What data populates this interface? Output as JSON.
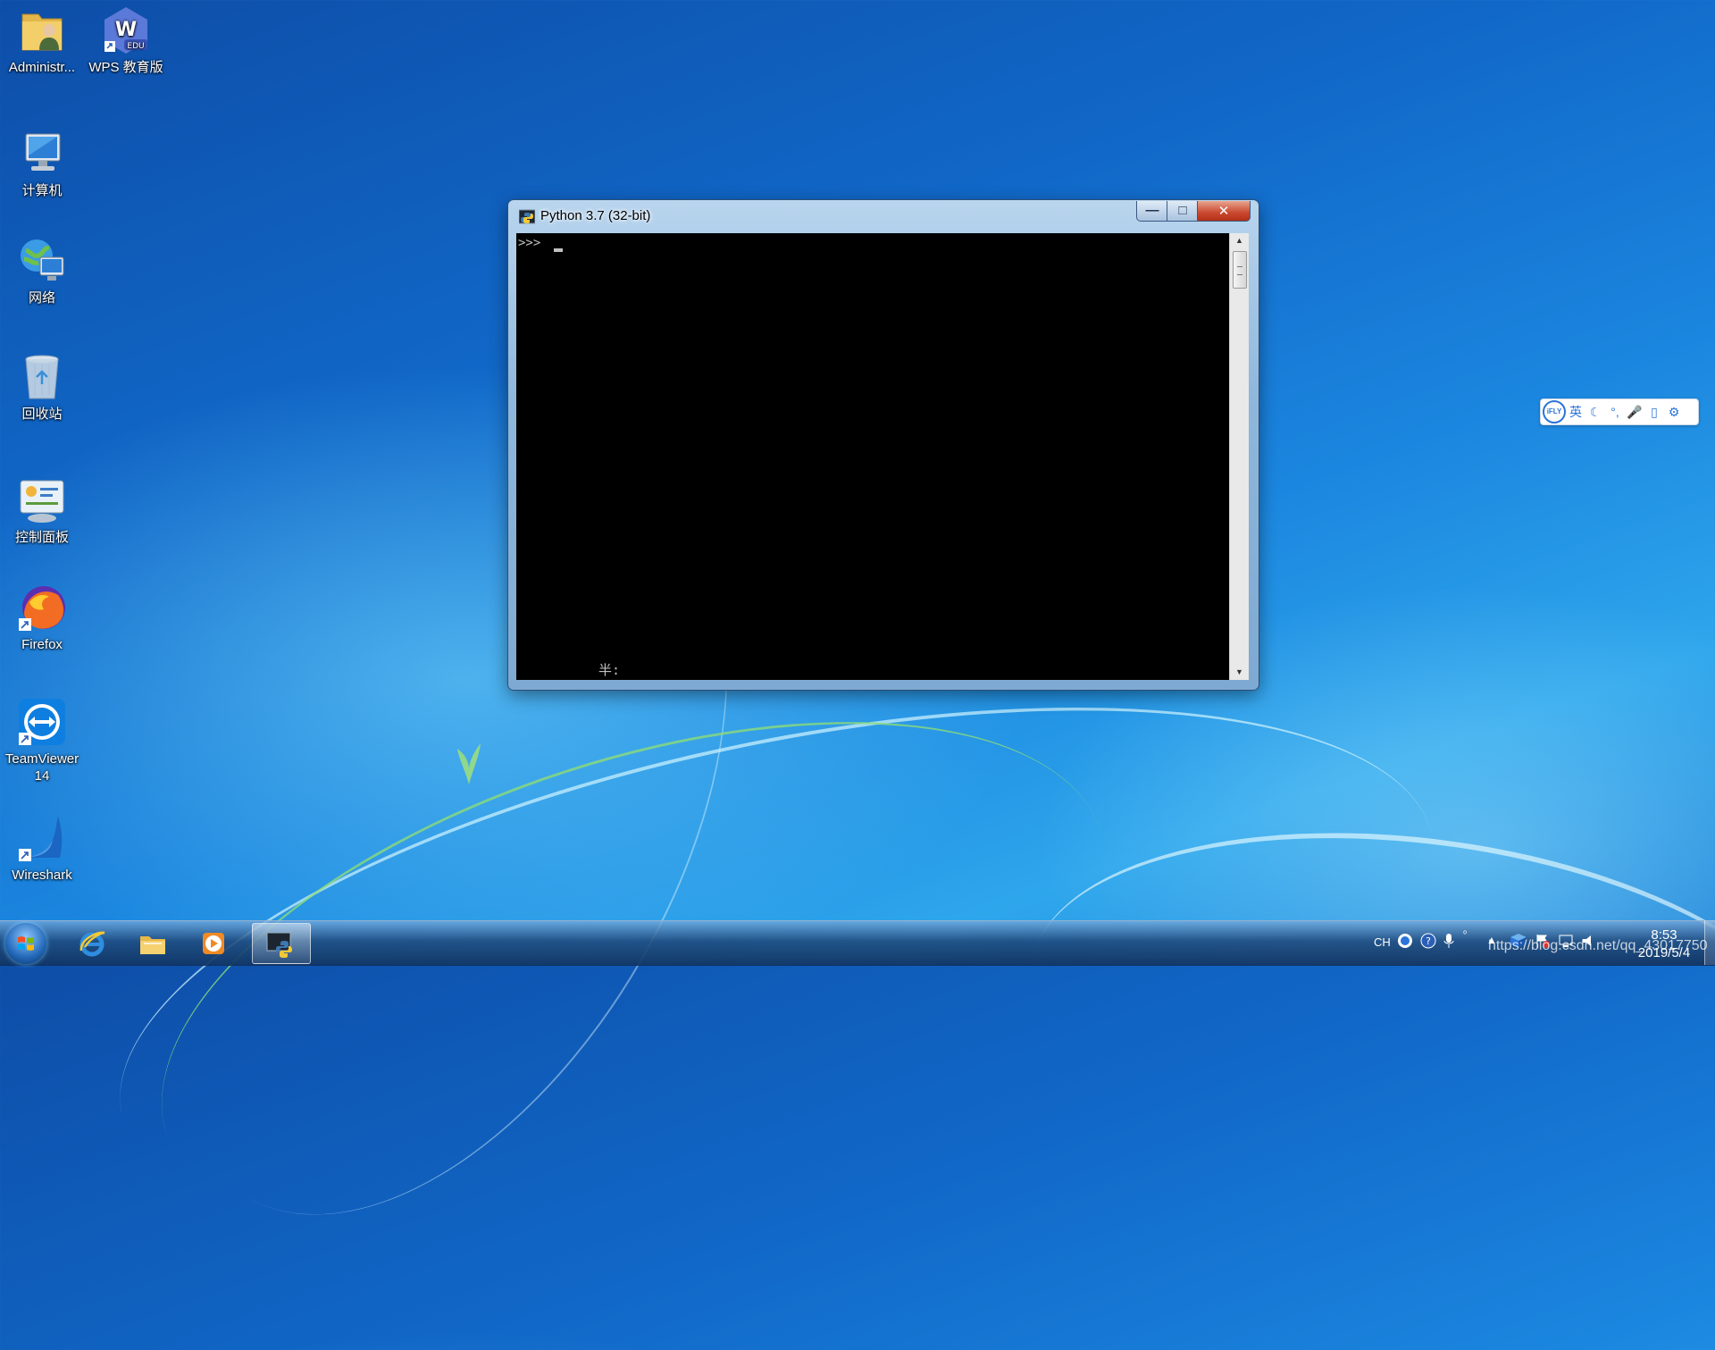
{
  "desktop": {
    "icons": [
      {
        "label": "Administr...",
        "icon": "user-folder-icon"
      },
      {
        "label": "WPS 教育版",
        "icon": "wps-edu-icon",
        "badge": "EDU"
      },
      {
        "label": "计算机",
        "icon": "computer-icon"
      },
      {
        "label": "网络",
        "icon": "network-icon"
      },
      {
        "label": "回收站",
        "icon": "recycle-bin-icon"
      },
      {
        "label": "控制面板",
        "icon": "control-panel-icon"
      },
      {
        "label": "Firefox",
        "icon": "firefox-icon"
      },
      {
        "label": "TeamViewer 14",
        "icon": "teamviewer-icon"
      },
      {
        "label": "Wireshark",
        "icon": "wireshark-icon"
      }
    ]
  },
  "window": {
    "title": "Python 3.7 (32-bit)",
    "console": {
      "prompt": ">>>",
      "ime_status": "半:"
    },
    "controls": {
      "minimize": "—",
      "maximize": "□",
      "close": "✕"
    }
  },
  "ime_toolbar": {
    "logo": "iFLY",
    "items": [
      "英",
      "☾",
      "°,",
      "🎤",
      "▯",
      "⚙"
    ]
  },
  "taskbar": {
    "pinned": [
      "internet-explorer-icon",
      "file-explorer-icon",
      "media-player-icon",
      "python-icon"
    ],
    "tray": {
      "language": "CH"
    },
    "clock": {
      "time": "8:53",
      "date": "2019/5/4"
    }
  },
  "watermark": "https://blog.csdn.net/qq_43017750",
  "colors": {
    "desktop_blue": "#1168c8",
    "console_bg": "#000000",
    "console_fg": "#c0c0c0",
    "close_red": "#c8482e"
  }
}
